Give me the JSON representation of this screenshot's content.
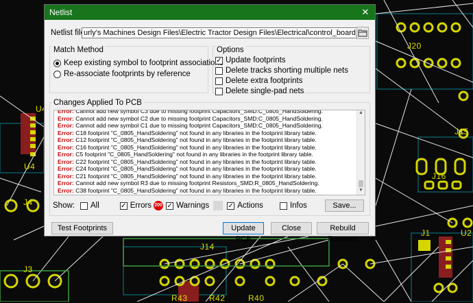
{
  "background": {
    "labels": [
      "U4",
      "J4",
      "J3",
      "J20",
      "J15",
      "J16",
      "J1",
      "U2",
      "J14",
      "R43",
      "R42",
      "R40"
    ]
  },
  "dialog": {
    "title": "Netlist",
    "close_glyph": "✕",
    "netlist_file_label": "Netlist file:",
    "netlist_file_value": "urly's Machines Design Files\\Electric Tractor Design Files\\Electrical\\control_board_R1\\control_board.net",
    "match_method": {
      "title": "Match Method",
      "options": [
        {
          "label": "Keep existing symbol to footprint associations",
          "selected": true
        },
        {
          "label": "Re-associate footprints by reference",
          "selected": false
        }
      ]
    },
    "options": {
      "title": "Options",
      "items": [
        {
          "label": "Update footprints",
          "checked": true
        },
        {
          "label": "Delete tracks shorting multiple nets",
          "checked": false
        },
        {
          "label": "Delete extra footprints",
          "checked": false
        },
        {
          "label": "Delete single-pad nets",
          "checked": false
        }
      ]
    },
    "changes": {
      "title": "Changes Applied To PCB",
      "lines": [
        {
          "severity": "Error:",
          "text": "Cannot add new symbol C3 due to missing footprint Capacitors_SMD:C_0805_HandSoldering."
        },
        {
          "severity": "Error:",
          "text": "Cannot add new symbol C2 due to missing footprint Capacitors_SMD:C_0805_HandSoldering."
        },
        {
          "severity": "Error:",
          "text": "Cannot add new symbol C1 due to missing footprint Capacitors_SMD:C_0805_HandSoldering."
        },
        {
          "severity": "Error:",
          "text": "C18 footprint \"C_0805_HandSoldering\" not found in any libraries in the footprint library table."
        },
        {
          "severity": "Error:",
          "text": "C12 footprint \"C_0805_HandSoldering\" not found in any libraries in the footprint library table."
        },
        {
          "severity": "Error:",
          "text": "C16 footprint \"C_0805_HandSoldering\" not found in any libraries in the footprint library table."
        },
        {
          "severity": "Error:",
          "text": "C5 footprint \"C_0805_HandSoldering\" not found in any libraries in the footprint library table."
        },
        {
          "severity": "Error:",
          "text": "C22 footprint \"C_0805_HandSoldering\" not found in any libraries in the footprint library table."
        },
        {
          "severity": "Error:",
          "text": "C24 footprint \"C_0805_HandSoldering\" not found in any libraries in the footprint library table."
        },
        {
          "severity": "Error:",
          "text": "C21 footprint \"C_0805_HandSoldering\" not found in any libraries in the footprint library table."
        },
        {
          "severity": "Error:",
          "text": "Cannot add new symbol R3 due to missing footprint Resistors_SMD:R_0805_HandSoldering."
        },
        {
          "severity": "Error:",
          "text": "C38 footprint \"C_0805_HandSoldering\" not found in any libraries in the footprint library table."
        }
      ]
    },
    "filters": {
      "show_label": "Show:",
      "all": {
        "label": "All",
        "checked": false
      },
      "errors": {
        "label": "Errors",
        "checked": true,
        "badge": "200"
      },
      "warnings": {
        "label": "Warnings",
        "checked": true
      },
      "actions": {
        "label": "Actions",
        "checked": true
      },
      "infos": {
        "label": "Infos",
        "checked": false
      },
      "save_label": "Save..."
    },
    "buttons": {
      "test_footprints": "Test Footprints",
      "update_pcb": "Update PCB",
      "close": "Close",
      "rebuild_ratsnest": "Rebuild Ratsnest"
    }
  }
}
